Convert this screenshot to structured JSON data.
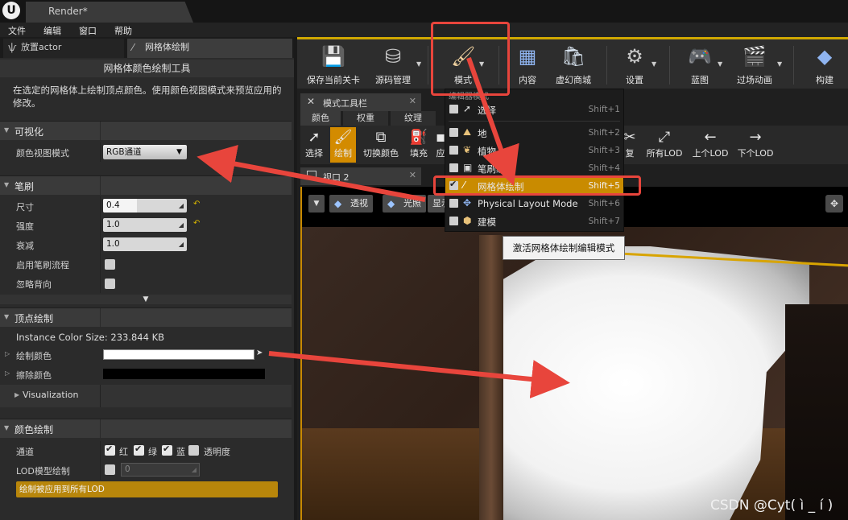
{
  "window": {
    "tab_title": "Render*"
  },
  "menubar": {
    "items": [
      "文件",
      "编辑",
      "窗口",
      "帮助"
    ]
  },
  "left_panel": {
    "tabs": [
      {
        "label": "放置actor",
        "icon": "place-actor-icon"
      },
      {
        "label": "网格体绘制",
        "icon": "brush-icon"
      }
    ],
    "title": "网格体颜色绘制工具",
    "description": "在选定的网格体上绘制顶点颜色。使用颜色视图模式来预览应用的修改。",
    "sections": {
      "visual": {
        "label": "可视化",
        "color_view_mode_label": "颜色视图模式",
        "color_view_mode_value": "RGB通道"
      },
      "brush": {
        "label": "笔刷",
        "size_label": "尺寸",
        "size_value": "0.4",
        "size_fraction": 0.4,
        "strength_label": "强度",
        "strength_value": "1.0",
        "falloff_label": "衰减",
        "falloff_value": "1.0",
        "flow_label": "启用笔刷流程",
        "ignore_back_label": "忽略背向"
      },
      "vertex": {
        "label": "顶点绘制",
        "instance_size": "Instance Color Size: 233.844 KB",
        "paint_color_label": "绘制颜色",
        "erase_color_label": "擦除颜色",
        "visualization_label": "Visualization",
        "paint_color": "#ffffff",
        "erase_color": "#000000"
      },
      "color_paint": {
        "label": "颜色绘制",
        "channel_label": "通道",
        "channels": [
          {
            "label": "红",
            "checked": true
          },
          {
            "label": "绿",
            "checked": true
          },
          {
            "label": "蓝",
            "checked": true
          },
          {
            "label": "透明度",
            "checked": false
          }
        ],
        "lod_label": "LOD模型绘制",
        "lod_value": "0",
        "apply_all_lod": "绘制被应用到所有LOD"
      }
    }
  },
  "toolbar": {
    "buttons": [
      {
        "label": "保存当前关卡",
        "icon": "save-icon"
      },
      {
        "label": "源码管理",
        "icon": "source-control-icon"
      },
      {
        "label": "模式",
        "icon": "modes-brush-icon"
      },
      {
        "label": "内容",
        "icon": "content-grid-icon"
      },
      {
        "label": "虚幻商城",
        "icon": "marketplace-bag-icon"
      },
      {
        "label": "设置",
        "icon": "settings-gear-icon"
      },
      {
        "label": "蓝图",
        "icon": "blueprint-gamepad-icon"
      },
      {
        "label": "过场动画",
        "icon": "cinematics-clapper-icon"
      },
      {
        "label": "构建",
        "icon": "build-cubes-icon"
      }
    ]
  },
  "modes_panel": {
    "tab_label": "模式工具栏",
    "subtabs": [
      "颜色",
      "权重",
      "纹理"
    ],
    "tools": [
      "选择",
      "绘制",
      "切换颜色",
      "填充",
      "应",
      "复",
      "所有LOD",
      "上个LOD",
      "下个LOD"
    ]
  },
  "viewport": {
    "tab_label": "视口 2",
    "buttons": [
      "透视",
      "光照",
      "显示"
    ]
  },
  "modes_menu": {
    "header": "编辑器模式",
    "items": [
      {
        "label": "选择",
        "shortcut": "Shift+1",
        "checked": false,
        "icon": "select-cursor-icon"
      },
      {
        "label": "地",
        "shortcut": "Shift+2",
        "checked": false,
        "icon": "landscape-icon"
      },
      {
        "label": "植物",
        "shortcut": "Shift+3",
        "checked": false,
        "icon": "foliage-icon"
      },
      {
        "label": "笔刷编辑",
        "shortcut": "Shift+4",
        "checked": false,
        "icon": "brush-edit-icon"
      },
      {
        "label": "网格体绘制",
        "shortcut": "Shift+5",
        "checked": true,
        "icon": "mesh-paint-icon"
      },
      {
        "label": "Physical Layout Mode",
        "shortcut": "Shift+6",
        "checked": false,
        "icon": "physical-layout-icon"
      },
      {
        "label": "建模",
        "shortcut": "Shift+7",
        "checked": false,
        "icon": "modeling-icon"
      }
    ],
    "tooltip": "激活网格体绘制编辑模式"
  },
  "annotation_color": "#e8453c",
  "accent_color": "#c98b00",
  "watermark": "CSDN @Cyt( ì _ í )"
}
